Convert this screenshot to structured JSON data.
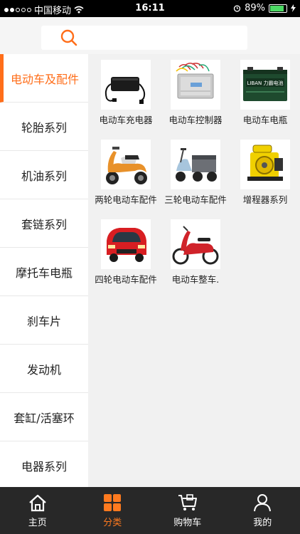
{
  "status_bar": {
    "carrier": "中国移动",
    "time": "16:11",
    "battery": "89%"
  },
  "search": {
    "icon": "search-icon"
  },
  "sidebar": {
    "items": [
      {
        "label": "电动车及配件",
        "active": true
      },
      {
        "label": "轮胎系列"
      },
      {
        "label": "机油系列"
      },
      {
        "label": "套链系列"
      },
      {
        "label": "摩托车电瓶"
      },
      {
        "label": "刹车片"
      },
      {
        "label": "发动机"
      },
      {
        "label": "套缸/活塞环"
      },
      {
        "label": "电器系列"
      }
    ]
  },
  "products": [
    {
      "label": "电动车充电器",
      "icon": "charger"
    },
    {
      "label": "电动车控制器",
      "icon": "controller"
    },
    {
      "label": "电动车电瓶",
      "icon": "battery",
      "brand": "LIBAN 力霸电池"
    },
    {
      "label": "两轮电动车配件",
      "icon": "scooter"
    },
    {
      "label": "三轮电动车配件",
      "icon": "tricycle"
    },
    {
      "label": "增程器系列",
      "icon": "generator"
    },
    {
      "label": "四轮电动车配件",
      "icon": "car"
    },
    {
      "label": "电动车整车.",
      "icon": "ebike"
    }
  ],
  "tabbar": {
    "tabs": [
      {
        "label": "主页",
        "icon": "home-icon"
      },
      {
        "label": "分类",
        "icon": "category-icon",
        "active": true
      },
      {
        "label": "购物车",
        "icon": "cart-icon"
      },
      {
        "label": "我的",
        "icon": "user-icon"
      }
    ]
  },
  "colors": {
    "accent": "#ff6e1a",
    "tabbar_bg": "#282828"
  }
}
